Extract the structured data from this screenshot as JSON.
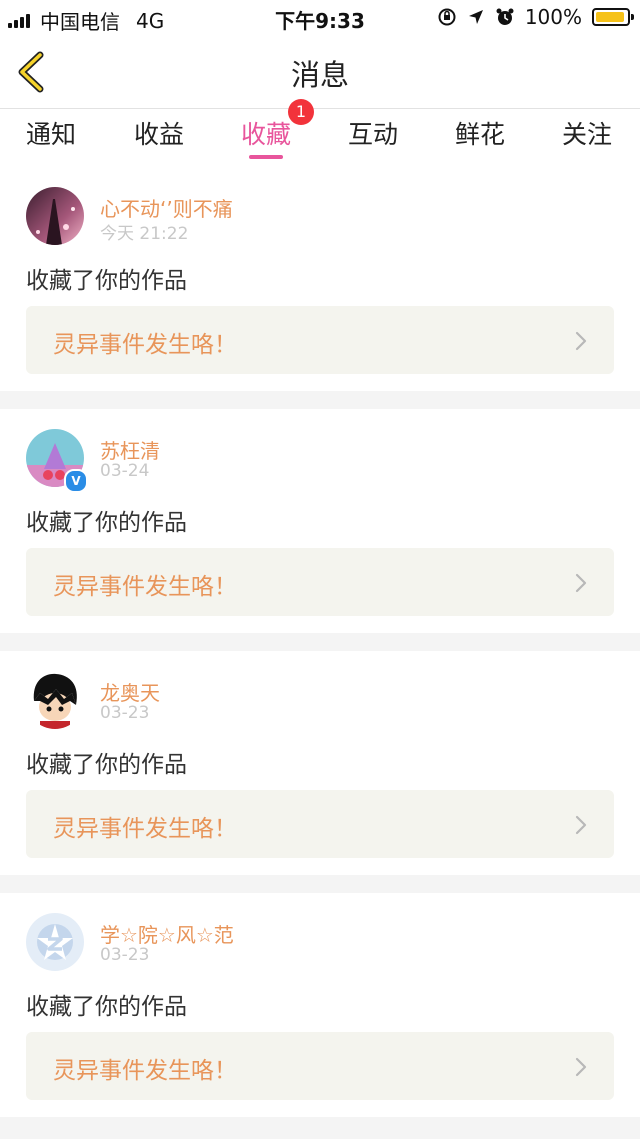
{
  "status_bar": {
    "carrier": "中国电信",
    "network": "4G",
    "time": "下午9:33",
    "battery": "100%",
    "battery_color": "#f6c21a"
  },
  "nav": {
    "back_icon": "chevron-left-icon",
    "title": "消息"
  },
  "tabs": [
    {
      "label": "通知"
    },
    {
      "label": "收益"
    },
    {
      "label": "收藏",
      "active": true
    },
    {
      "label": "互动"
    },
    {
      "label": "鲜花"
    },
    {
      "label": "关注"
    }
  ],
  "tab_badge": "1",
  "colors": {
    "accent_pink": "#e8559c",
    "name_orange": "#e8955a",
    "badge_red": "#f2333b",
    "verified_blue": "#2a8de6"
  },
  "messages": [
    {
      "name": "心不动‘’则不痛",
      "time": "今天 21:22",
      "action": "收藏了你的作品",
      "work_title": "灵异事件发生咯！"
    },
    {
      "name": "苏枉清",
      "time": "03-24",
      "action": "收藏了你的作品",
      "work_title": "灵异事件发生咯！",
      "verified": true,
      "verified_mark": "V"
    },
    {
      "name": "龙奥天",
      "time": "03-23",
      "action": "收藏了你的作品",
      "work_title": "灵异事件发生咯！"
    },
    {
      "name": "学☆院☆风☆范",
      "time": "03-23",
      "action": "收藏了你的作品",
      "work_title": "灵异事件发生咯！"
    }
  ]
}
